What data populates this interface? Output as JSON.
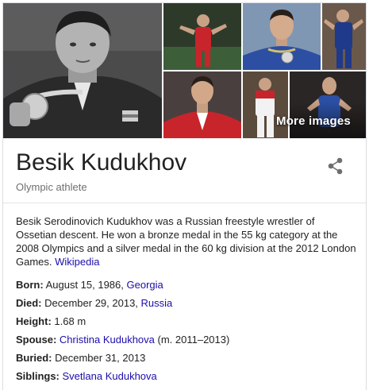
{
  "images": {
    "more_label": "More images"
  },
  "entity": {
    "name": "Besik Kudukhov",
    "type": "Olympic athlete"
  },
  "description": {
    "text": "Besik Serodinovich Kudukhov was a Russian freestyle wrestler of Ossetian descent. He won a bronze medal in the 55 kg category at the 2008 Olympics and a silver medal in the 60 kg division at the 2012 London Games.",
    "source_link": "Wikipedia"
  },
  "facts": [
    {
      "key": "Born:",
      "value": "August 15, 1986, ",
      "link": "Georgia",
      "suffix": ""
    },
    {
      "key": "Died:",
      "value": "December 29, 2013, ",
      "link": "Russia",
      "suffix": ""
    },
    {
      "key": "Height:",
      "value": "1.68 m",
      "link": "",
      "suffix": ""
    },
    {
      "key": "Spouse:",
      "value": "",
      "link": "Christina Kudukhova",
      "suffix": " (m. 2011–2013)"
    },
    {
      "key": "Buried:",
      "value": "December 31, 2013",
      "link": "",
      "suffix": ""
    },
    {
      "key": "Siblings:",
      "value": "",
      "link": "Svetlana Kudukhova",
      "suffix": ""
    }
  ],
  "colors": {
    "link": "#1a0dab",
    "wrestler_red": "#c8242b",
    "wrestler_blue": "#2c4fa3"
  },
  "icons": {
    "share": "share-icon"
  }
}
